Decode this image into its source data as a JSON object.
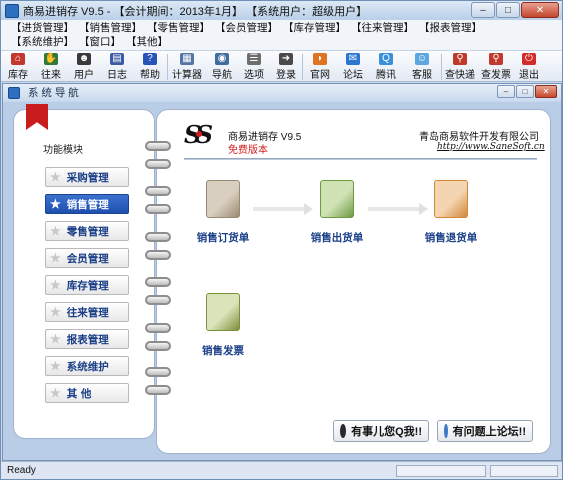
{
  "window": {
    "title": "商易进销存 V9.5 - 【会计期间：2013年1月】 【系统用户：超级用户】",
    "min": "–",
    "max": "□",
    "close": "✕"
  },
  "menu": [
    "【进货管理】",
    "【销售管理】",
    "【零售管理】",
    "【会员管理】",
    "【库存管理】",
    "【往来管理】",
    "【报表管理】",
    "【系统维护】",
    "【窗口】",
    "【其他】"
  ],
  "toolbar": [
    {
      "label": "库存",
      "icon": "house-icon",
      "color": "#c3372c"
    },
    {
      "label": "往来",
      "icon": "handshake-icon",
      "color": "#2f7a3b"
    },
    {
      "label": "用户",
      "icon": "user-icon",
      "color": "#3a3a3a"
    },
    {
      "label": "日志",
      "icon": "book-icon",
      "color": "#3f5aa5"
    },
    {
      "label": "帮助",
      "icon": "help-icon",
      "color": "#2754b6"
    },
    {
      "label": "计算器",
      "icon": "calculator-icon",
      "color": "#5574a6"
    },
    {
      "label": "导航",
      "icon": "magnifier-icon",
      "color": "#3f6e9e"
    },
    {
      "label": "选项",
      "icon": "options-icon",
      "color": "#6e6e6e"
    },
    {
      "label": "登录",
      "icon": "login-icon",
      "color": "#4a4a4a"
    },
    {
      "label": "官网",
      "icon": "rss-icon",
      "color": "#e0731f"
    },
    {
      "label": "论坛",
      "icon": "forum-icon",
      "color": "#2b77d0"
    },
    {
      "label": "腾讯",
      "icon": "qq-icon",
      "color": "#3a8fd8"
    },
    {
      "label": "客服",
      "icon": "customer-service-icon",
      "color": "#5ea6e0"
    },
    {
      "label": "查快递",
      "icon": "search-express-icon",
      "color": "#c0392b"
    },
    {
      "label": "查发票",
      "icon": "search-invoice-icon",
      "color": "#c0392b"
    },
    {
      "label": "退出",
      "icon": "power-icon",
      "color": "#d42b2b"
    }
  ],
  "subwindow": {
    "title": "系 统 导 航",
    "min": "–",
    "max": "□",
    "close": "✕"
  },
  "nav": {
    "module_title": "功能模块",
    "modules": [
      {
        "label": "采购管理",
        "active": false
      },
      {
        "label": "销售管理",
        "active": true
      },
      {
        "label": "零售管理",
        "active": false
      },
      {
        "label": "会员管理",
        "active": false
      },
      {
        "label": "库存管理",
        "active": false
      },
      {
        "label": "往来管理",
        "active": false
      },
      {
        "label": "报表管理",
        "active": false
      },
      {
        "label": "系统维护",
        "active": false
      },
      {
        "label": "其  他",
        "active": false
      }
    ]
  },
  "brand": {
    "logo": "SS",
    "product": "商易进销存 V9.5",
    "edition": "免费版本",
    "company": "青岛商易软件开发有限公司",
    "url": "http://www.SaneSoft.cn"
  },
  "functions": [
    {
      "label": "销售订货单",
      "icon": "order-doc-icon",
      "colors": [
        "#d9cfc0",
        "#9a8a72"
      ]
    },
    {
      "label": "销售出货单",
      "icon": "shipment-doc-icon",
      "colors": [
        "#cfe2b3",
        "#6e9a43"
      ]
    },
    {
      "label": "销售退货单",
      "icon": "return-doc-icon",
      "colors": [
        "#f4d5b1",
        "#d2873a"
      ]
    },
    {
      "label": "销售发票",
      "icon": "invoice-icon",
      "colors": [
        "#d9e4b8",
        "#7d8f3c"
      ]
    }
  ],
  "buttons": {
    "qq": "有事儿您Q我!!",
    "forum": "有问题上论坛!!"
  },
  "status": {
    "text": "Ready"
  }
}
